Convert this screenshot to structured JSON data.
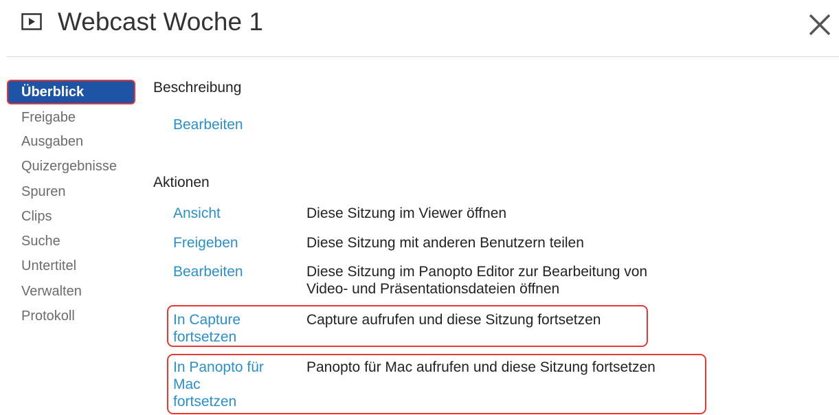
{
  "header": {
    "title": "Webcast Woche 1",
    "icon": "play-icon",
    "close_icon": "close-icon"
  },
  "sidebar": {
    "items": [
      {
        "label": "Überblick",
        "active": true
      },
      {
        "label": "Freigabe"
      },
      {
        "label": "Ausgaben"
      },
      {
        "label": "Quizergebnisse"
      },
      {
        "label": "Spuren"
      },
      {
        "label": "Clips"
      },
      {
        "label": "Suche"
      },
      {
        "label": "Untertitel"
      },
      {
        "label": "Verwalten"
      },
      {
        "label": "Protokoll"
      }
    ]
  },
  "description": {
    "heading": "Beschreibung",
    "edit_link": "Bearbeiten"
  },
  "actions": {
    "heading": "Aktionen",
    "items": [
      {
        "link": "Ansicht",
        "description": "Diese Sitzung im Viewer öffnen"
      },
      {
        "link": "Freigeben",
        "description": "Diese Sitzung mit anderen Benutzern teilen"
      },
      {
        "link": "Bearbeiten",
        "description_line1": "Diese Sitzung im Panopto Editor zur Bearbeitung von",
        "description_line2": "Video- und Präsentationsdateien öffnen"
      },
      {
        "link_line1": "In Capture",
        "link_line2": "fortsetzen",
        "description": "Capture aufrufen und diese Sitzung fortsetzen"
      },
      {
        "link_line1": "In Panopto für",
        "link_line2": "Mac",
        "link_line3": "fortsetzen",
        "description": "Panopto für Mac aufrufen und diese Sitzung fortsetzen"
      }
    ]
  },
  "colors": {
    "active_nav_bg": "#1e54a6",
    "link": "#2b8fc9",
    "highlight_border": "#e53935"
  }
}
